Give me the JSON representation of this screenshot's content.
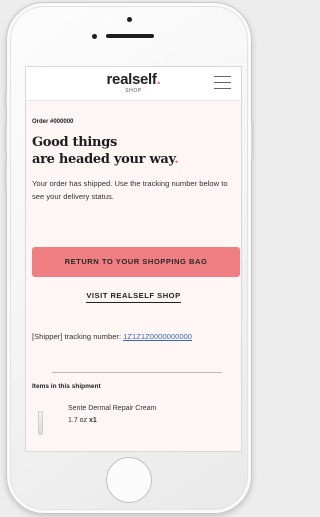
{
  "shop_header": {
    "logo_text": "realself",
    "logo_period": ".",
    "logo_subtitle": "SHOP",
    "menu_icon": "hamburger-menu-icon"
  },
  "order": {
    "number_label": "Order #000000",
    "headline_line1": "Good things",
    "headline_line2": "are headed your way",
    "headline_period": ".",
    "message": "Your order has shipped. Use the tracking number below to see your delivery status."
  },
  "actions": {
    "return_button_label": "RETURN TO YOUR SHOPPING BAG",
    "visit_shop_label": "VISIT REALSELF SHOP"
  },
  "tracking": {
    "prefix": "[Shipper] tracking number: ",
    "number": "1Z1Z1Z0000000000"
  },
  "shipment": {
    "title": "Items in this shipment",
    "items": [
      {
        "name": "Sente Dermal Repair Cream",
        "size": "1.7 oz",
        "quantity": "x1"
      }
    ]
  },
  "colors": {
    "accent": "#f07f84",
    "page_bg": "#fdf6f4",
    "link": "#3c68b8"
  }
}
